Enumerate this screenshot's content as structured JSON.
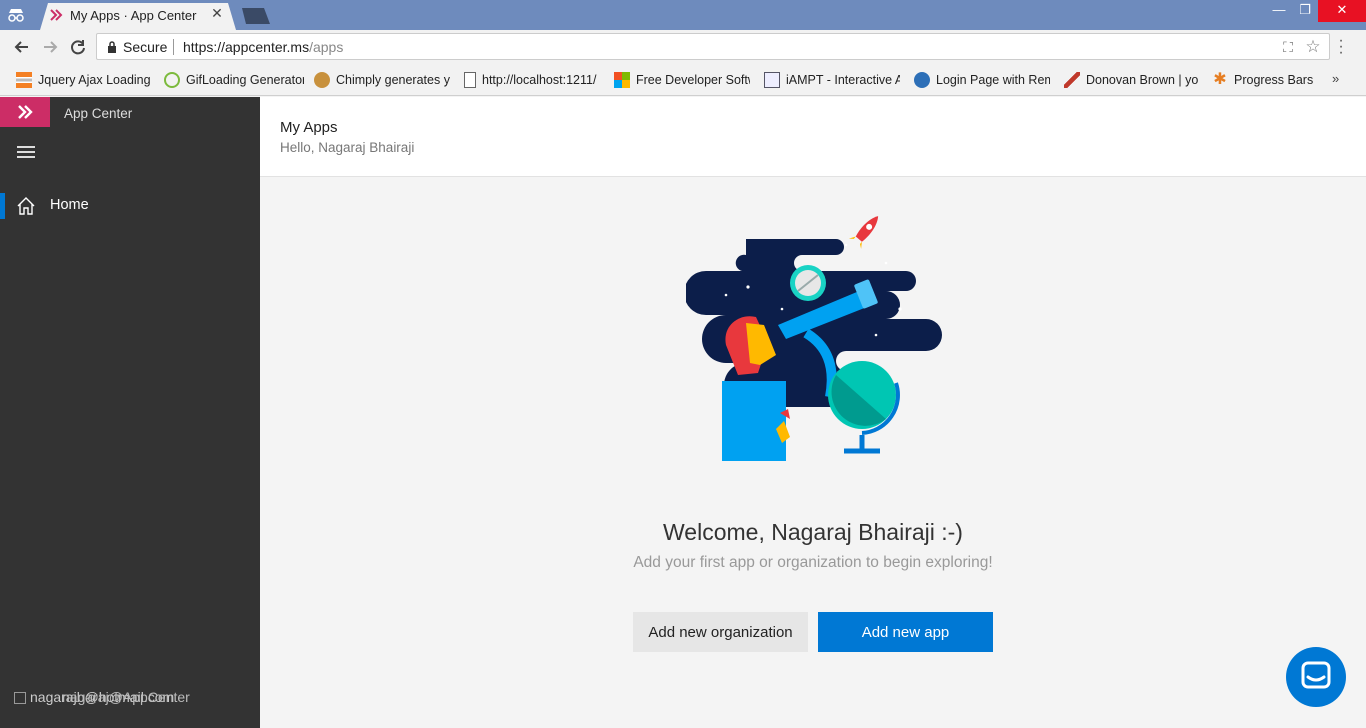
{
  "browser": {
    "tab_title": "My Apps · App Center",
    "security_label": "Secure",
    "url_host": "https://appcenter.ms",
    "url_path": "/apps",
    "bookmarks": [
      {
        "label": "Jquery Ajax Loading i",
        "icon": "stack-icon"
      },
      {
        "label": "GifLoading Generator",
        "icon": "lg-icon"
      },
      {
        "label": "Chimply generates yo",
        "icon": "monkey-icon"
      },
      {
        "label": "http://localhost:1211/",
        "icon": "page-icon"
      },
      {
        "label": "Free Developer Softw",
        "icon": "microsoft-icon"
      },
      {
        "label": "iAMPT - Interactive A",
        "icon": "doc-icon"
      },
      {
        "label": "Login Page with Rem",
        "icon": "aspnet-icon"
      },
      {
        "label": "Donovan Brown | yo",
        "icon": "hammer-icon"
      },
      {
        "label": "Progress Bars",
        "icon": "asterisk-icon"
      }
    ],
    "more_label": "»"
  },
  "sidebar": {
    "app_name": "App Center",
    "home_label": "Home",
    "user_alt": "nagarajb@hotmail.com",
    "user_overlap": "nagaraj@AppCenter"
  },
  "header": {
    "title": "My Apps",
    "greeting": "Hello, Nagaraj Bhairaji"
  },
  "main": {
    "welcome": "Welcome, Nagaraj Bhairaji :-)",
    "hint": "Add your first app or organization to begin exploring!",
    "add_org_label": "Add new organization",
    "add_app_label": "Add new app"
  },
  "colors": {
    "brand": "#cc2d66",
    "accent": "#0078d4",
    "sidebar": "#333333"
  }
}
